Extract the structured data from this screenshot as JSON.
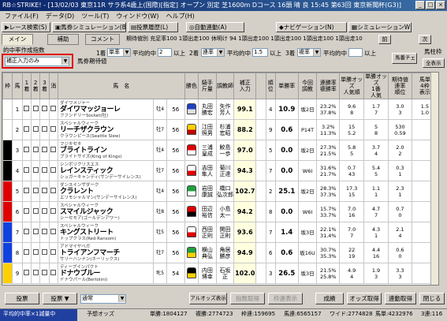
{
  "window": {
    "title": "RB☆STRIKE! - [13/02/03 東京11R サラ系4歳上(国際)[指定] オープン 別定 芝1600m Dコース 16頭 晴 良 15:45 第63回 東京新聞杯(G3)]",
    "btn_min": "_",
    "btn_max": "□",
    "btn_close": "×"
  },
  "menu": [
    "ファイル(F)",
    "データ(D)",
    "ツール(T)",
    "ウィンドウ(W)",
    "ヘルプ(H)"
  ],
  "toolbar": [
    "レース検索(S)",
    "馬券シミュレーション(B)",
    "投票履歴(L)",
    "自動連動(A)",
    "ナビゲーション(N)",
    "シミュレーションWIN(E)"
  ],
  "tabs": {
    "main": "メイン",
    "hosoku": "補助",
    "comment": "コメント"
  },
  "racebar": "期待値別 充足率100 1頭出走100 休明け 94 1頭出走100 1頭出走100 1頭出走100 1頭出走100",
  "nav": {
    "prev": "前",
    "next": "次"
  },
  "controls": {
    "label_yosou": "的中率作成指数",
    "mode_value": "補正入力のみ",
    "label_baken": "馬券期待値",
    "c1_label": "1着",
    "c1_val": "単率",
    "c2_label": "平均的中",
    "c2_val": "2",
    "c3_label": "2着",
    "c3_val": "連率",
    "c4_label": "平均的中",
    "c4_val": "1.5",
    "c5_label": "3着",
    "c5_val": "複率",
    "c6_label": "平均的中",
    "ijou": "以上",
    "check_btn": "馬番チェック",
    "baken_kind": "馬柱枠",
    "zen": "全表示"
  },
  "grid": {
    "headers": [
      "枠",
      "馬",
      "1着",
      "2着",
      "3着",
      "消",
      "馬　名",
      "",
      "",
      "勝色",
      "騎手\n斤量",
      "調教師",
      "補正\n入力",
      "",
      "順位",
      "単勝率",
      "今回\n調教",
      "連勝率\n複勝率",
      "単勝オッズ\n人気順",
      "単勝オッズ\n1番\n人気",
      "期待値\n連率\n順位",
      "馬単\n4枠\n表示"
    ],
    "rows": [
      {
        "waku": "1",
        "wakucolor": "#ffffff",
        "umaban": "1",
        "sire": "ダイワメジャー",
        "name": "ダイワマッジョーレ",
        "dam": "ファンドリーSocket(牡)",
        "sex": "牡4",
        "kinryo": "56",
        "owner": "丸田\n勝宏",
        "trainer": "矢作\n芳人",
        "corr": "99.1",
        "tan": "4",
        "odds": "10.9",
        "chokyo": "坂2日",
        "rensho": "23.2%\n37.8%",
        "tanodds": "9.6\n8",
        "ninki": "1.7\n7",
        "kitai": "3.0\n3",
        "vals": "1.5\n1.0",
        "silk": "#2040c0",
        "silk2": "#e0e0e0"
      },
      {
        "waku": "1",
        "wakucolor": "#ffffff",
        "umaban": "2",
        "sire": "スペシャルウィーク",
        "name": "リーチザクラウン",
        "dam": "クラウンピース(Seattle Slew)",
        "sex": "牡7",
        "kinryo": "56",
        "owner": "江田\n照男",
        "trainer": "杉浦\n宏昭",
        "corr": "88.2",
        "tan": "9",
        "odds": "0.6",
        "chokyo": "P14T",
        "rensho": "3.2%\n11.3%",
        "tanodds": "15\n5.2",
        "ninki": "5\n8",
        "kitai": "530\n0.59",
        "vals": "",
        "silk": "#ffd000",
        "silk2": "#c00000"
      },
      {
        "waku": "2",
        "wakucolor": "#000000",
        "umaban": "3",
        "sire": "フジキセキ",
        "name": "ブライトライン",
        "dam": "ブライトサイズ(King of Kings)",
        "sex": "牡4",
        "kinryo": "56",
        "owner": "三浦\n皇成",
        "trainer": "鮫島\n一歩",
        "corr": "97.0",
        "tan": "5",
        "odds": "0.0",
        "chokyo": "坂2日",
        "rensho": "27.3%\n21.5%",
        "tanodds": "5.8\n5",
        "ninki": "3.7\n4",
        "kitai": "2.0\n2",
        "vals": "",
        "silk": "#e00000",
        "silk2": "#ffffff"
      },
      {
        "waku": "2",
        "wakucolor": "#000000",
        "umaban": "4",
        "sire": "シンボリクリスエス",
        "name": "レインスティック",
        "dam": "シュガーキャンディ(サンデーサイレンス)",
        "sex": "牡7",
        "kinryo": "56",
        "owner": "吉田\n隼人",
        "trainer": "菊川\n正達",
        "corr": "94.3",
        "tan": "7",
        "odds": "0.0",
        "chokyo": "W6I",
        "rensho": "31.6%\n21.7%",
        "tanodds": "0.7\n43",
        "ninki": "5.4\n5",
        "kitai": "0.3\n1",
        "vals": "",
        "silk": "#ffffff",
        "silk2": "#e00000"
      },
      {
        "waku": "3",
        "wakucolor": "#e00000",
        "umaban": "5",
        "sire": "ダンスインザダーク",
        "name": "クラレント",
        "dam": "エリモシャルマン(サンデーサイレンス)",
        "sex": "牡4",
        "kinryo": "56",
        "owner": "岩田\n康誠",
        "trainer": "橋口\n弘次郎",
        "corr": "102.7",
        "tan": "2",
        "odds": "25.1",
        "chokyo": "坂2日",
        "rensho": "28.3%\n37.3%",
        "tanodds": "17.3\n15",
        "ninki": "1.1\n1",
        "kitai": "2.3\n1",
        "vals": "",
        "silk": "#20a040",
        "silk2": "#ffffff"
      },
      {
        "waku": "3",
        "wakucolor": "#e00000",
        "umaban": "6",
        "sire": "スペシャルウィーク",
        "name": "スマイルジャック",
        "dam": "シーセモア(ゴールデンアワー)",
        "sex": "牡8",
        "kinryo": "56",
        "owner": "田辺\n裕信",
        "trainer": "小島\n太一",
        "corr": "94.2",
        "tan": "8",
        "odds": "0.0",
        "chokyo": "W6I",
        "rensho": "15.7%\n33.7%",
        "tanodds": "7.0\n16",
        "ninki": "4.7\n7",
        "kitai": "0.7\n0",
        "vals": "",
        "silk": "#e00000",
        "silk2": "#000000"
      },
      {
        "waku": "4",
        "wakucolor": "#1040e0",
        "umaban": "7",
        "sire": "スペシャルウィーク",
        "name": "キングストリート",
        "dam": "トップクラス(Red Ransom)",
        "sex": "牡5",
        "kinryo": "56",
        "owner": "西田\n正則",
        "trainer": "関田\n正則",
        "corr": "93.6",
        "tan": "7",
        "odds": "1.4",
        "chokyo": "坂3日",
        "rensho": "22.1%\n31.4%",
        "tanodds": "7.0\n7",
        "ninki": "4.3\n1",
        "kitai": "2.1\n4",
        "vals": "",
        "silk": "#ffffff",
        "silk2": "#e00000"
      },
      {
        "waku": "4",
        "wakucolor": "#1040e0",
        "umaban": "8",
        "sire": "アドマイヤベガ",
        "name": "トライアンフマーチ",
        "dam": "サリーハンナン(ホーリックス)",
        "sex": "牡7",
        "kinryo": "56",
        "owner": "横山\n典弘",
        "trainer": "角居\n勝彦",
        "corr": "94.9",
        "tan": "6",
        "odds": "0.6",
        "chokyo": "坂16U",
        "rensho": "30.7%\n35.3%",
        "tanodds": "22\n19",
        "ninki": "4.4\n16",
        "kitai": "0.6\n0",
        "vals": "",
        "silk": "#20a040",
        "silk2": "#ffd000"
      },
      {
        "waku": "5",
        "wakucolor": "#ffd000",
        "umaban": "9",
        "sire": "ディープインパクト",
        "name": "ドナウブルー",
        "dam": "ドナウパール(Bertolini)",
        "sex": "牝5",
        "kinryo": "54",
        "owner": "内田\n博幸",
        "trainer": "石坂\n正",
        "corr": "102.0",
        "tan": "3",
        "odds": "26.5",
        "chokyo": "坂3日",
        "rensho": "21.5%\n25.8%",
        "tanodds": "4.9\n4",
        "ninki": "1.9\n3",
        "kitai": "3.3\n3",
        "vals": "",
        "silk": "#000000",
        "silk2": "#ffd000"
      }
    ]
  },
  "bottom": {
    "vote": "投票",
    "vote2": "投票",
    "mode": "通常",
    "scale": "全",
    "alert": "アルオッズ表示",
    "shiteishi": "指数取得",
    "kekka": "枠連表示",
    "seiseki": "成績",
    "odds_get": "オッズ取得",
    "renkei": "連動取得",
    "close": "閉じる"
  },
  "status": {
    "hit": "平均的中率×1減量中",
    "yosou": "予想オッズ",
    "tan": "単勝:1804127",
    "fuku": "複勝:2774723",
    "wakuren": "枠連:159695",
    "umaren": "馬連:6565157",
    "wide": "ワイド:2774828",
    "umatan": "馬単:4232976",
    "sanren": "3連:116"
  }
}
